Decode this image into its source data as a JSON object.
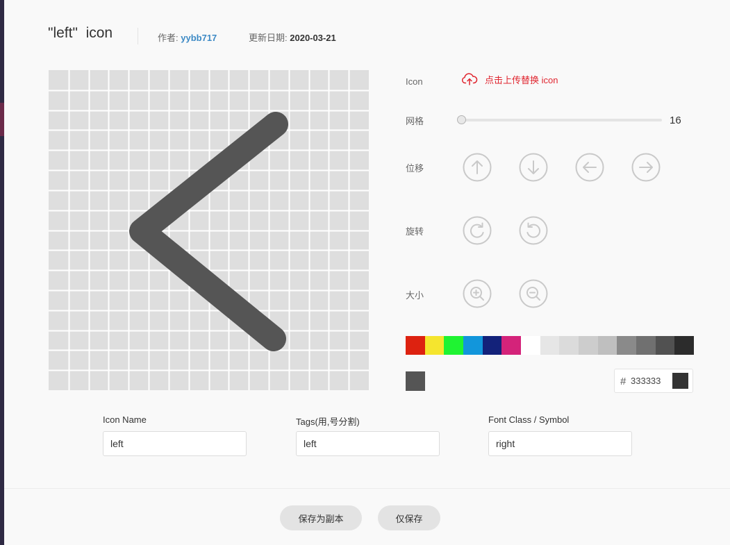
{
  "header": {
    "title": "\"left\"  icon",
    "author_label": "作者:",
    "author_value": "yybb717",
    "date_label": "更新日期:",
    "date_value": "2020-03-21"
  },
  "editor": {
    "grid_cells": 16,
    "line_color": "#555555",
    "grid_bg": "#dedede",
    "grid_line_color": "#ffffff"
  },
  "controls": {
    "icon_label": "Icon",
    "upload_text": "点击上传替换 icon",
    "grid_label": "网格",
    "grid_value": "16",
    "move_label": "位移",
    "rotate_label": "旋转",
    "size_label": "大小",
    "move_buttons": [
      "arrow-up-icon",
      "arrow-down-icon",
      "arrow-left-icon",
      "arrow-right-icon"
    ],
    "rotate_buttons": [
      "rotate-clockwise-icon",
      "rotate-counterclockwise-icon"
    ],
    "size_buttons": [
      "zoom-in-icon",
      "zoom-out-icon"
    ]
  },
  "palette": {
    "swatches": [
      "#dd2210",
      "#f5e52e",
      "#1ff332",
      "#1296db",
      "#13227a",
      "#d4237a",
      "#ffffff",
      "#e6e6e6",
      "#dbdbdb",
      "#cdcdcd",
      "#bfbfbf",
      "#8a8a8a",
      "#707070",
      "#515151",
      "#2c2c2c"
    ],
    "current_color": "#555555",
    "hex_symbol": "#",
    "hex_value": "333333",
    "hex_preview": "#333333"
  },
  "fields": {
    "name_label": "Icon Name",
    "name_value": "left",
    "tags_label": "Tags(用,号分割)",
    "tags_value": "left",
    "class_label": "Font Class / Symbol",
    "class_value": "right"
  },
  "footer": {
    "save_copy_label": "保存为副本",
    "save_only_label": "仅保存"
  }
}
